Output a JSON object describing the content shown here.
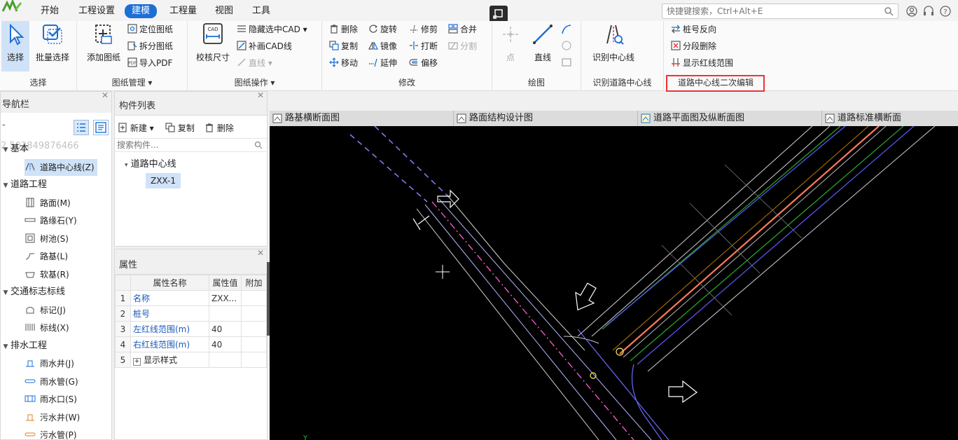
{
  "menubar": {
    "tabs": [
      {
        "label": "开始"
      },
      {
        "label": "工程设置"
      },
      {
        "label": "建模"
      },
      {
        "label": "工程量"
      },
      {
        "label": "视图"
      },
      {
        "label": "工具"
      }
    ],
    "active_tab": "建模",
    "search_placeholder": "快捷键搜索，Ctrl+Alt+E"
  },
  "ribbon": {
    "select_group": {
      "label": "选择",
      "select": "选择",
      "batch_select": "批量选择"
    },
    "drawing_mgmt": {
      "label": "图纸管理",
      "add_drawing": "添加图纸",
      "locate": "定位图纸",
      "split": "拆分图纸",
      "import_pdf": "导入PDF"
    },
    "drawing_ops": {
      "label": "图纸操作",
      "calibrate": "校核尺寸",
      "hide_cad": "隐藏选中CAD",
      "fill_cad": "补画CAD线",
      "line": "直线"
    },
    "modify": {
      "label": "修改",
      "delete": "删除",
      "rotate": "旋转",
      "trim": "修剪",
      "merge": "合并",
      "copy": "复制",
      "mirror": "镜像",
      "break": "打断",
      "split": "分割",
      "move": "移动",
      "extend": "延伸",
      "offset": "偏移"
    },
    "draw": {
      "label": "绘图",
      "point": "点",
      "line": "直线"
    },
    "identify": {
      "label": "识别道路中心线",
      "btn": "识别中心线"
    },
    "secondary": {
      "label": "道路中心线二次编辑",
      "reverse": "桩号反向",
      "segment_delete": "分段删除",
      "show_redline": "显示红线范围"
    }
  },
  "nav": {
    "title": "导航栏",
    "filter_text": "-",
    "code_text": "2 502849876466",
    "categories": [
      {
        "label": "基本",
        "items": [
          {
            "label": "道路中心线(Z)",
            "icon": "centerline-icon"
          }
        ]
      },
      {
        "label": "道路工程",
        "items": [
          {
            "label": "路面(M)",
            "icon": "pavement-icon"
          },
          {
            "label": "路缘石(Y)",
            "icon": "curb-icon"
          },
          {
            "label": "树池(S)",
            "icon": "tree-pit-icon"
          },
          {
            "label": "路基(L)",
            "icon": "subgrade-icon"
          },
          {
            "label": "软基(R)",
            "icon": "soft-base-icon"
          }
        ]
      },
      {
        "label": "交通标志标线",
        "items": [
          {
            "label": "标记(J)",
            "icon": "marker-icon"
          },
          {
            "label": "标线(X)",
            "icon": "marking-icon"
          }
        ]
      },
      {
        "label": "排水工程",
        "items": [
          {
            "label": "雨水井(J)",
            "icon": "rain-well-icon"
          },
          {
            "label": "雨水管(G)",
            "icon": "rain-pipe-icon"
          },
          {
            "label": "雨水口(S)",
            "icon": "rain-inlet-icon"
          },
          {
            "label": "污水井(W)",
            "icon": "sewage-well-icon"
          },
          {
            "label": "污水管(P)",
            "icon": "sewage-pipe-icon"
          }
        ]
      }
    ]
  },
  "components": {
    "title": "构件列表",
    "new": "新建",
    "copy": "复制",
    "delete": "删除",
    "search_placeholder": "搜索构件...",
    "group": "道路中心线",
    "item": "ZXX-1"
  },
  "properties": {
    "title": "属性",
    "headers": [
      "属性名称",
      "属性值",
      "附加"
    ],
    "rows": [
      {
        "idx": "1",
        "name": "名称",
        "value": "ZXX..."
      },
      {
        "idx": "2",
        "name": "桩号",
        "value": ""
      },
      {
        "idx": "3",
        "name": "左红线范围(m)",
        "value": "40"
      },
      {
        "idx": "4",
        "name": "右红线范围(m)",
        "value": "40"
      },
      {
        "idx": "5",
        "name": "显示样式",
        "value": ""
      }
    ]
  },
  "drawing_tabs": [
    {
      "label": "路基横断面图"
    },
    {
      "label": "路面结构设计图"
    },
    {
      "label": "道路平面图及纵断面图"
    },
    {
      "label": "道路标准横断面"
    }
  ],
  "colors": {
    "accent": "#1d6fd6",
    "highlight": "#e33333",
    "selection": "#cfe2f7"
  }
}
